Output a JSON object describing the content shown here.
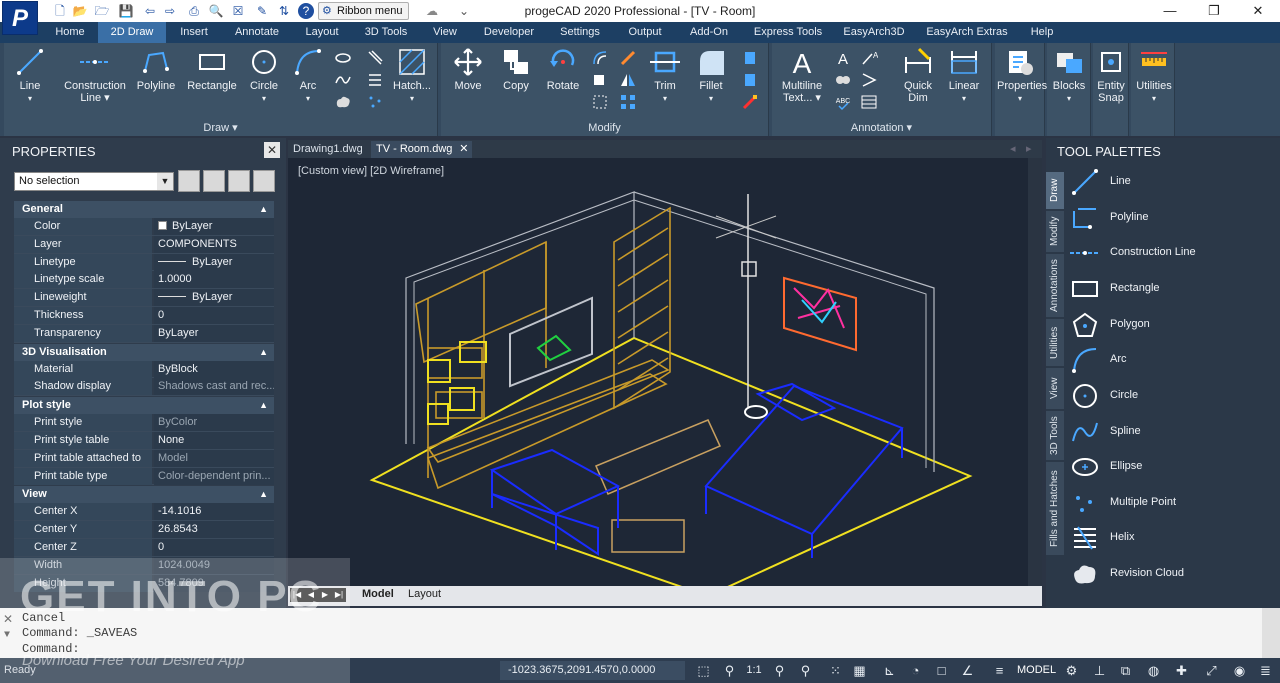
{
  "window": {
    "title": "progeCAD 2020 Professional - [TV - Room]",
    "logo_letter": "P",
    "ribbon_menu_label": "Ribbon menu",
    "minimize": "—",
    "restore": "❐",
    "close": "✕"
  },
  "ribbon_tabs": [
    "Home",
    "2D Draw",
    "Insert",
    "Annotate",
    "Layout",
    "3D Tools",
    "View",
    "Developer",
    "Settings",
    "Output",
    "Add-On",
    "Express Tools",
    "EasyArch3D",
    "EasyArch Extras",
    "Help"
  ],
  "active_ribbon_tab": "2D Draw",
  "ribbon": {
    "draw": {
      "label": "Draw ▾",
      "line": "Line",
      "construction_line": "Construction\nLine ▾",
      "polyline": "Polyline",
      "rectangle": "Rectangle",
      "circle": "Circle",
      "arc": "Arc",
      "hatch": "Hatch..."
    },
    "modify": {
      "label": "Modify",
      "move": "Move",
      "copy": "Copy",
      "rotate": "Rotate",
      "trim": "Trim",
      "fillet": "Fillet"
    },
    "annotation": {
      "label": "Annotation ▾",
      "multiline_text": "Multiline\nText... ▾",
      "quick_dim": "Quick\nDim",
      "linear": "Linear"
    },
    "extra": {
      "properties": "Properties",
      "blocks": "Blocks",
      "entity_snap": "Entity\nSnap",
      "utilities": "Utilities"
    }
  },
  "properties": {
    "title": "PROPERTIES",
    "close": "✕",
    "selection": "No selection",
    "sections": [
      {
        "name": "General",
        "rows": [
          {
            "k": "Color",
            "v": "ByLayer",
            "swatch": "#ffffff"
          },
          {
            "k": "Layer",
            "v": "COMPONENTS"
          },
          {
            "k": "Linetype",
            "v": "ByLayer",
            "line": true
          },
          {
            "k": "Linetype scale",
            "v": "1.0000"
          },
          {
            "k": "Lineweight",
            "v": "ByLayer",
            "line": true
          },
          {
            "k": "Thickness",
            "v": "0"
          },
          {
            "k": "Transparency",
            "v": "ByLayer"
          }
        ]
      },
      {
        "name": "3D Visualisation",
        "rows": [
          {
            "k": "Material",
            "v": "ByBlock"
          },
          {
            "k": "Shadow display",
            "v": "Shadows cast and rec...",
            "dim": true
          }
        ]
      },
      {
        "name": "Plot style",
        "rows": [
          {
            "k": "Print style",
            "v": "ByColor",
            "dim": true
          },
          {
            "k": "Print style table",
            "v": "None"
          },
          {
            "k": "Print table attached to",
            "v": "Model",
            "dim": true
          },
          {
            "k": "Print table type",
            "v": "Color-dependent prin...",
            "dim": true
          }
        ]
      },
      {
        "name": "View",
        "rows": [
          {
            "k": "Center X",
            "v": "-14.1016"
          },
          {
            "k": "Center Y",
            "v": "26.8543"
          },
          {
            "k": "Center Z",
            "v": "0"
          },
          {
            "k": "Width",
            "v": "1024.0049",
            "dim": true,
            "kdim": true
          },
          {
            "k": "Height",
            "v": "584.7809",
            "dim": true,
            "kdim": true
          }
        ]
      }
    ]
  },
  "doc_tabs": [
    {
      "label": "Drawing1.dwg",
      "active": false
    },
    {
      "label": "TV - Room.dwg",
      "active": true,
      "close": "✕"
    }
  ],
  "canvas": {
    "view_label": "[Custom view] [2D Wireframe]"
  },
  "layout_tabs": [
    "Model",
    "Layout"
  ],
  "palette": {
    "title": "TOOL PALETTES",
    "vertical_tabs": [
      "Draw",
      "Modify",
      "Annotations",
      "Utilities",
      "View",
      "3D Tools",
      "Fills and Hatches"
    ],
    "items": [
      "Line",
      "Polyline",
      "Construction Line",
      "Rectangle",
      "Polygon",
      "Arc",
      "Circle",
      "Spline",
      "Ellipse",
      "Multiple Point",
      "Helix",
      "Revision Cloud"
    ]
  },
  "command": {
    "lines": [
      "Cancel",
      "Command: _SAVEAS",
      "Command:"
    ]
  },
  "status": {
    "ready": "Ready",
    "coords": "-1023.3675,2091.4570,0.0000",
    "scale": "1:1",
    "model": "MODEL"
  },
  "watermark": {
    "text": "GET INTO PC",
    "subtext": "Download Free Your Desired App"
  },
  "colors": {
    "ribbon_tab_bar": "#1d3f63",
    "active_tab": "#3a6fa6",
    "canvas_bg": "#1e2736",
    "furniture_orange": "#c89a2a",
    "sofa_blue": "#1a2cff",
    "floor_yellow": "#f0e020"
  }
}
